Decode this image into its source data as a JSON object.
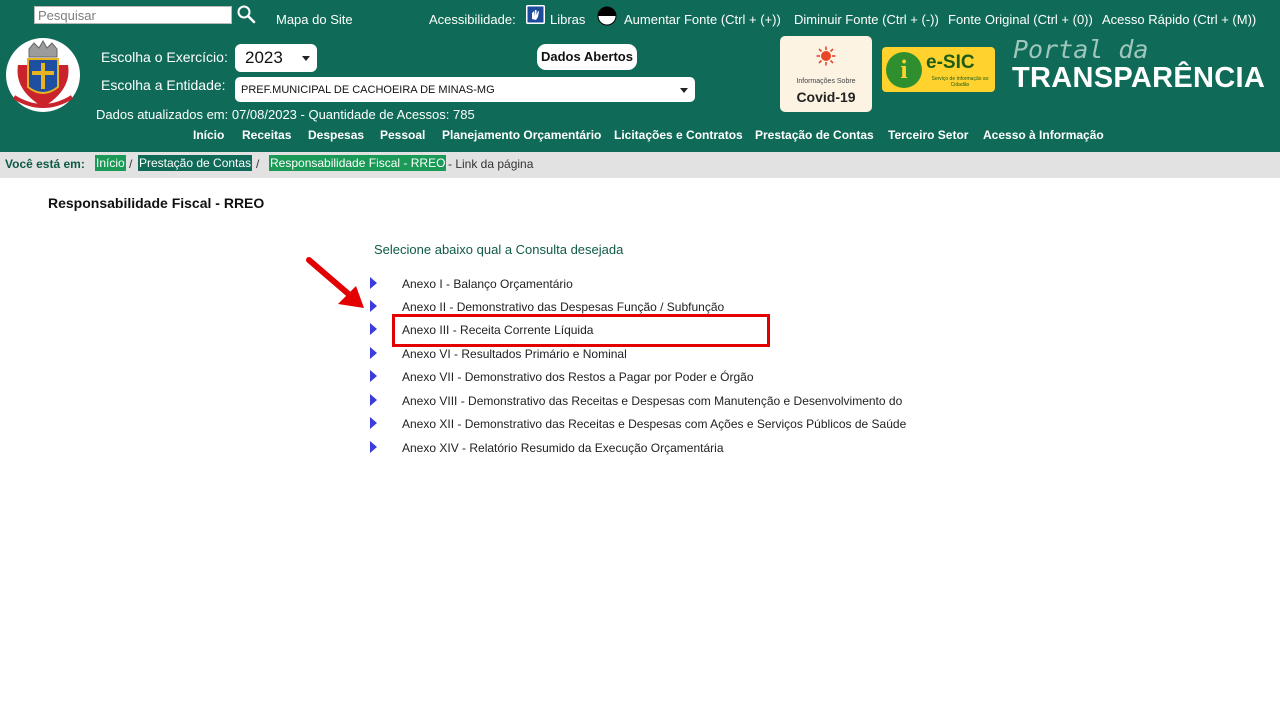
{
  "topbar": {
    "search_placeholder": "Pesquisar",
    "mapa_site": "Mapa do Site",
    "acessibilidade": "Acessibilidade:",
    "libras": "Libras",
    "aumentar_fonte": "Aumentar Fonte (Ctrl + (+))",
    "diminuir_fonte": "Diminuir Fonte (Ctrl + (-))",
    "fonte_original": "Fonte Original (Ctrl + (0))",
    "acesso_rapido": "Acesso Rápido (Ctrl + (M))"
  },
  "header": {
    "exercicio_label": "Escolha o Exercício:",
    "exercicio_value": "2023",
    "entidade_label": "Escolha a Entidade:",
    "entidade_value": "PREF.MUNICIPAL DE CACHOEIRA DE MINAS-MG",
    "dados_abertos": "Dados Abertos",
    "updated": "Dados atualizados em: 07/08/2023 - Quantidade de Acessos: 785",
    "covid_small": "Informações Sobre",
    "covid_big": "Covid-19",
    "esic_label": "e-SIC",
    "esic_sub": "Serviço de Informação ao Cidadão",
    "portal_da": "Portal da",
    "transparencia": "TRANSPARÊNCIA"
  },
  "nav": {
    "items": [
      "Início",
      "Receitas",
      "Despesas",
      "Pessoal",
      "Planejamento Orçamentário",
      "Licitações e Contratos",
      "Prestação de Contas",
      "Terceiro Setor",
      "Acesso à Informação"
    ]
  },
  "breadcrumb": {
    "label": "Você está em:",
    "home": "Início",
    "mid": "Prestação de Contas",
    "current": "Responsabilidade Fiscal - RREO",
    "sep": "/",
    "tail": "- Link da página"
  },
  "content": {
    "title": "Responsabilidade Fiscal - RREO",
    "subtitle": "Selecione abaixo qual a Consulta desejada",
    "annexes": [
      "Anexo I - Balanço Orçamentário",
      "Anexo II - Demonstrativo das Despesas Função / Subfunção",
      "Anexo III - Receita Corrente Líquida",
      "Anexo VI - Resultados Primário e Nominal",
      "Anexo VII - Demonstrativo dos Restos a Pagar por Poder e Órgão",
      "Anexo VIII - Demonstrativo das Receitas e Despesas com Manutenção e Desenvolvimento do",
      "Anexo XII - Demonstrativo das Receitas e Despesas com Ações e Serviços Públicos de Saúde",
      "Anexo XIV - Relatório Resumido da Execução Orçamentária"
    ]
  },
  "colors": {
    "brand_green": "#0f6b57",
    "crumb_green": "#1a9a56",
    "highlight_red": "#e30000",
    "bullet_blue": "#3b3bde"
  }
}
